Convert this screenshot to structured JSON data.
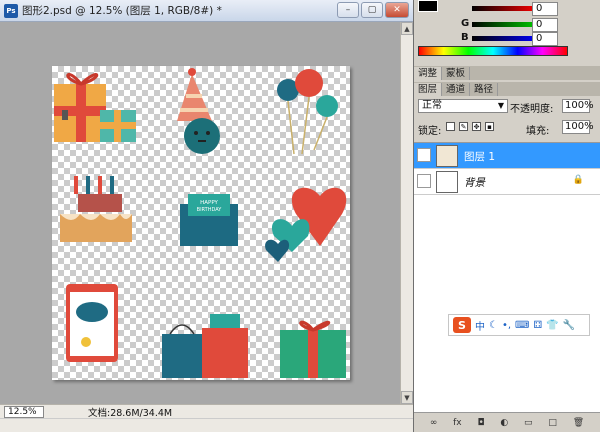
{
  "document": {
    "title": "图形2.psd @ 12.5% (图层 1, RGB/8#) *",
    "window_buttons": [
      "–",
      "▢",
      "✕"
    ],
    "zoom": "12.5%",
    "doc_info": "文档:28.6M/34.4M",
    "canvas_items": [
      "gift boxes",
      "party hat character",
      "balloons",
      "birthday cake",
      "birthday card wallet",
      "hearts",
      "tablet birthday message",
      "shopping bags",
      "green gift box"
    ],
    "card_text": [
      "HAPPY",
      "BIRTHDAY"
    ]
  },
  "color_panel": {
    "channels": [
      {
        "label": "",
        "value": "0",
        "color": "#cc0000"
      },
      {
        "label": "G",
        "value": "0",
        "color": "#00aa00"
      },
      {
        "label": "B",
        "value": "0",
        "color": "#0000cc"
      }
    ]
  },
  "panel_tabs_1": [
    "调整",
    "蒙板"
  ],
  "panel_tabs_2": [
    "图层",
    "通道",
    "路径"
  ],
  "layer_options": {
    "blend_mode": "正常",
    "opacity_label": "不透明度:",
    "opacity_value": "100%",
    "lock_label": "锁定:",
    "fill_label": "填充:",
    "fill_value": "100%"
  },
  "layers": [
    {
      "name": "图层 1",
      "selected": true
    },
    {
      "name": "背景",
      "selected": false
    }
  ],
  "ime_bar": {
    "logo": "S",
    "mode": "中"
  },
  "footer_icons": [
    "link-icon",
    "fx-icon",
    "mask-icon",
    "adjustment-icon",
    "folder-icon",
    "new-layer-icon",
    "trash-icon"
  ]
}
